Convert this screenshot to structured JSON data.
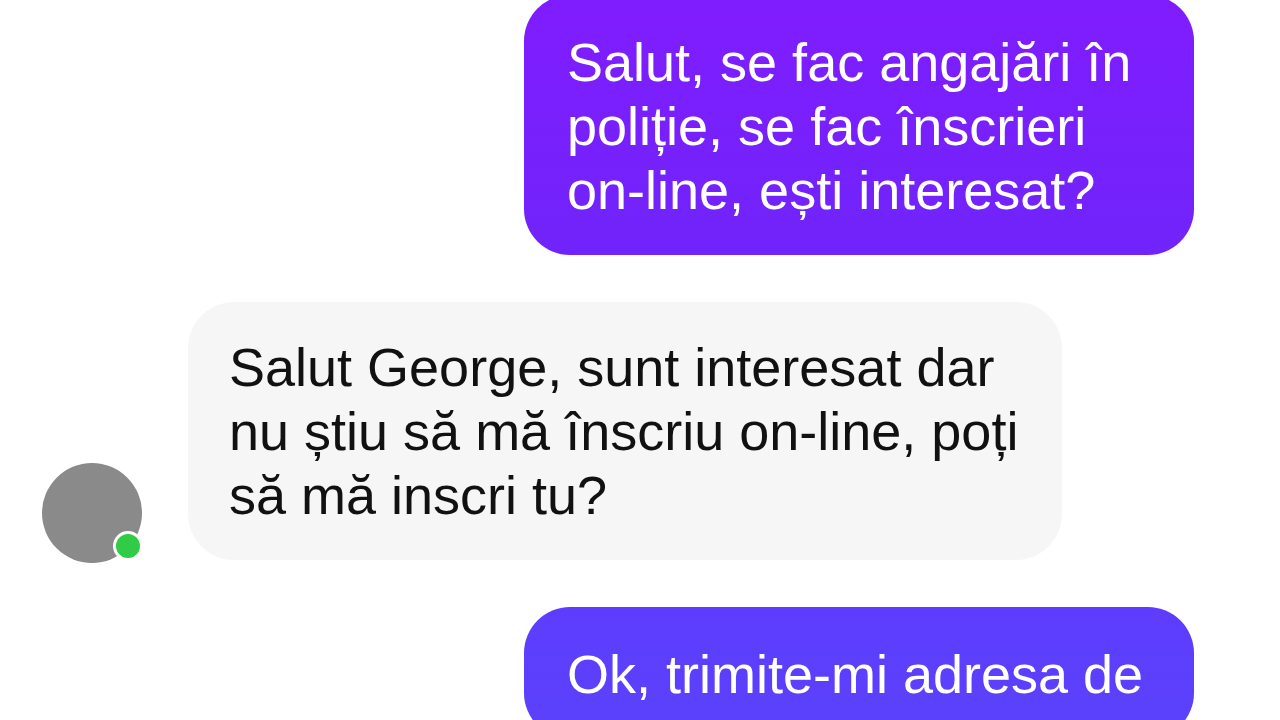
{
  "messages": [
    {
      "kind": "sent",
      "text": "Salut, se fac angajări în poliție, se fac înscrieri on-line, ești interesat?"
    },
    {
      "kind": "received",
      "text": "Salut George, sunt interesat dar nu știu să mă înscriu on-line, poți să mă inscri tu?",
      "avatar": {
        "online": true
      }
    },
    {
      "kind": "sent",
      "text": "Ok, trimite-mi adresa de"
    }
  ]
}
